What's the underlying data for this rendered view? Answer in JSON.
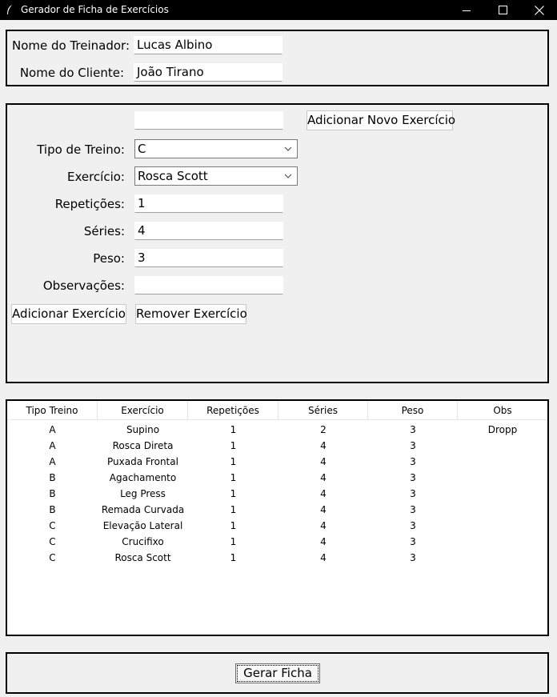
{
  "window": {
    "title": "Gerador de Ficha de Exercícios"
  },
  "trainer": {
    "label": "Nome do Treinador:",
    "value": "Lucas Albino"
  },
  "client": {
    "label": "Nome do Cliente:",
    "value": "João Tirano"
  },
  "new_exercise": {
    "value": "",
    "button": "Adicionar Novo Exercício"
  },
  "form": {
    "tipo_label": "Tipo de Treino:",
    "tipo_value": "C",
    "exercicio_label": "Exercício:",
    "exercicio_value": "Rosca Scott",
    "rep_label": "Repetições:",
    "rep_value": "1",
    "series_label": "Séries:",
    "series_value": "4",
    "peso_label": "Peso:",
    "peso_value": "3",
    "obs_label": "Observações:",
    "obs_value": "",
    "add_button": "Adicionar Exercício",
    "remove_button": "Remover Exercício"
  },
  "table": {
    "columns": [
      "Tipo Treino",
      "Exercício",
      "Repetições",
      "Séries",
      "Peso",
      "Obs"
    ],
    "rows": [
      [
        "A",
        "Supino",
        "1",
        "2",
        "3",
        "Dropp"
      ],
      [
        "A",
        "Rosca Direta",
        "1",
        "4",
        "3",
        ""
      ],
      [
        "A",
        "Puxada Frontal",
        "1",
        "4",
        "3",
        ""
      ],
      [
        "B",
        "Agachamento",
        "1",
        "4",
        "3",
        ""
      ],
      [
        "B",
        "Leg Press",
        "1",
        "4",
        "3",
        ""
      ],
      [
        "B",
        "Remada Curvada",
        "1",
        "4",
        "3",
        ""
      ],
      [
        "C",
        "Elevação Lateral",
        "1",
        "4",
        "3",
        ""
      ],
      [
        "C",
        "Crucifixo",
        "1",
        "4",
        "3",
        ""
      ],
      [
        "C",
        "Rosca Scott",
        "1",
        "4",
        "3",
        ""
      ]
    ]
  },
  "generate": {
    "button": "Gerar Ficha"
  }
}
